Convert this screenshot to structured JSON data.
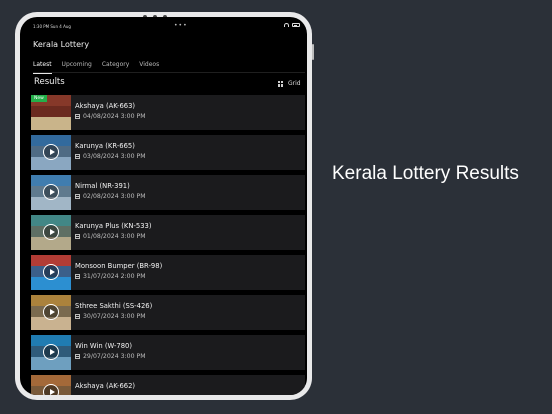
{
  "status_bar": {
    "time": "1:30 PM  Sun 4 Aug"
  },
  "app": {
    "title": "Kerala Lottery"
  },
  "tabs": [
    {
      "label": "Latest"
    },
    {
      "label": "Upcoming"
    },
    {
      "label": "Category"
    },
    {
      "label": "Videos"
    }
  ],
  "results": {
    "title": "Results",
    "view_toggle": "Grid"
  },
  "badge_new": "New",
  "items": [
    {
      "name": "Akshaya (AK-663)",
      "date": "04/08/2024 3:00 PM"
    },
    {
      "name": "Karunya (KR-665)",
      "date": "03/08/2024 3:00 PM"
    },
    {
      "name": "Nirmal (NR-391)",
      "date": "02/08/2024 3:00 PM"
    },
    {
      "name": "Karunya Plus (KN-533)",
      "date": "01/08/2024 3:00 PM"
    },
    {
      "name": "Monsoon Bumper (BR-98)",
      "date": "31/07/2024 2:00 PM"
    },
    {
      "name": "Sthree Sakthi (SS-426)",
      "date": "30/07/2024 3:00 PM"
    },
    {
      "name": "Win Win (W-780)",
      "date": "29/07/2024 3:00 PM"
    },
    {
      "name": "Akshaya (AK-662)",
      "date": ""
    }
  ],
  "promo": {
    "headline": "Kerala Lottery Results"
  },
  "colors": {
    "background": "#2b3038",
    "new_badge": "#23b04a",
    "list_item": "#1b1b1d"
  }
}
